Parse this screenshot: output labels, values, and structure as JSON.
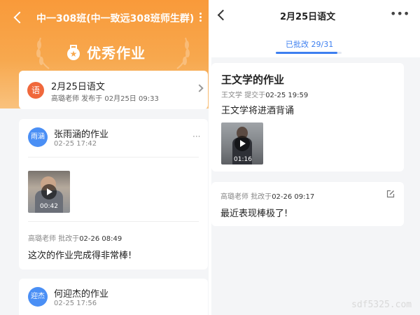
{
  "left": {
    "header": {
      "title": "中一308班(中一致远308班师生群)"
    },
    "banner": {
      "text": "优秀作业"
    },
    "assignment": {
      "subject_badge": "语",
      "title": "2月25日语文",
      "meta": "高璐老师 发布于 02月25日 09:33"
    },
    "homework": [
      {
        "avatar": "雨涵",
        "title": "张雨涵的作业",
        "date": "02-25 17:42",
        "video_duration": "00:42",
        "teacher": "高璐老师",
        "reviewed_label": "批改于",
        "reviewed_time": "02-26 08:49",
        "comment": "这次的作业完成得非常棒!"
      },
      {
        "avatar": "迎杰",
        "title": "何迎杰的作业",
        "date": "02-25 17:56"
      }
    ]
  },
  "right": {
    "header": {
      "title": "2月25日语文"
    },
    "tab": {
      "label": "已批改 29/31",
      "progress": 0.935
    },
    "submission": {
      "title": "王文学的作业",
      "student": "王文学",
      "submitted_label": "提交于",
      "submitted_time": "02-25 19:59",
      "content": "王文学将进酒背诵",
      "video_duration": "01:16"
    },
    "review": {
      "teacher": "高璐老师",
      "reviewed_label": "批改于",
      "reviewed_time": "02-26 09:17",
      "comment": "最近表现棒极了!"
    }
  },
  "watermark": "sdf5325.com",
  "colors": {
    "orange": "#f99a3a",
    "accent_blue": "#3d7ff0",
    "subject_red": "#f0683c",
    "avatar_blue": "#4a8ff5"
  }
}
